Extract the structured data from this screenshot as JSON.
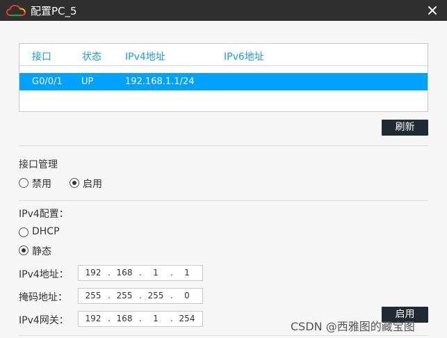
{
  "window": {
    "title": "配置PC_5",
    "close_glyph": "✕"
  },
  "interfaces": {
    "columns": [
      "接口",
      "状态",
      "IPv4地址",
      "IPv6地址"
    ],
    "rows": [
      {
        "iface": "G0/0/1",
        "status": "UP",
        "ipv4": "192.168.1.1/24",
        "ipv6": ""
      }
    ],
    "refresh_label": "刷新"
  },
  "iface_mgmt": {
    "heading": "接口管理",
    "options": [
      {
        "label": "禁用",
        "checked": false
      },
      {
        "label": "启用",
        "checked": true
      }
    ]
  },
  "ipv4": {
    "heading": "IPv4配置：",
    "options": [
      {
        "label": "DHCP",
        "checked": false
      },
      {
        "label": "静态",
        "checked": true
      }
    ],
    "fields": [
      {
        "label": "IPv4地址：",
        "octets": [
          "192",
          "168",
          "1",
          "1"
        ]
      },
      {
        "label": "掩码地址：",
        "octets": [
          "255",
          "255",
          "255",
          "0"
        ]
      },
      {
        "label": "IPv4网关：",
        "octets": [
          "192",
          "168",
          "1",
          "254"
        ]
      }
    ],
    "apply_label": "启用"
  },
  "watermark": "CSDN @西雅图的藏宝图",
  "colors": {
    "titlebar": "#2f2f2f",
    "header_text": "#1e9ad6",
    "selection": "#00a2ff",
    "button": "#1f2a33"
  }
}
